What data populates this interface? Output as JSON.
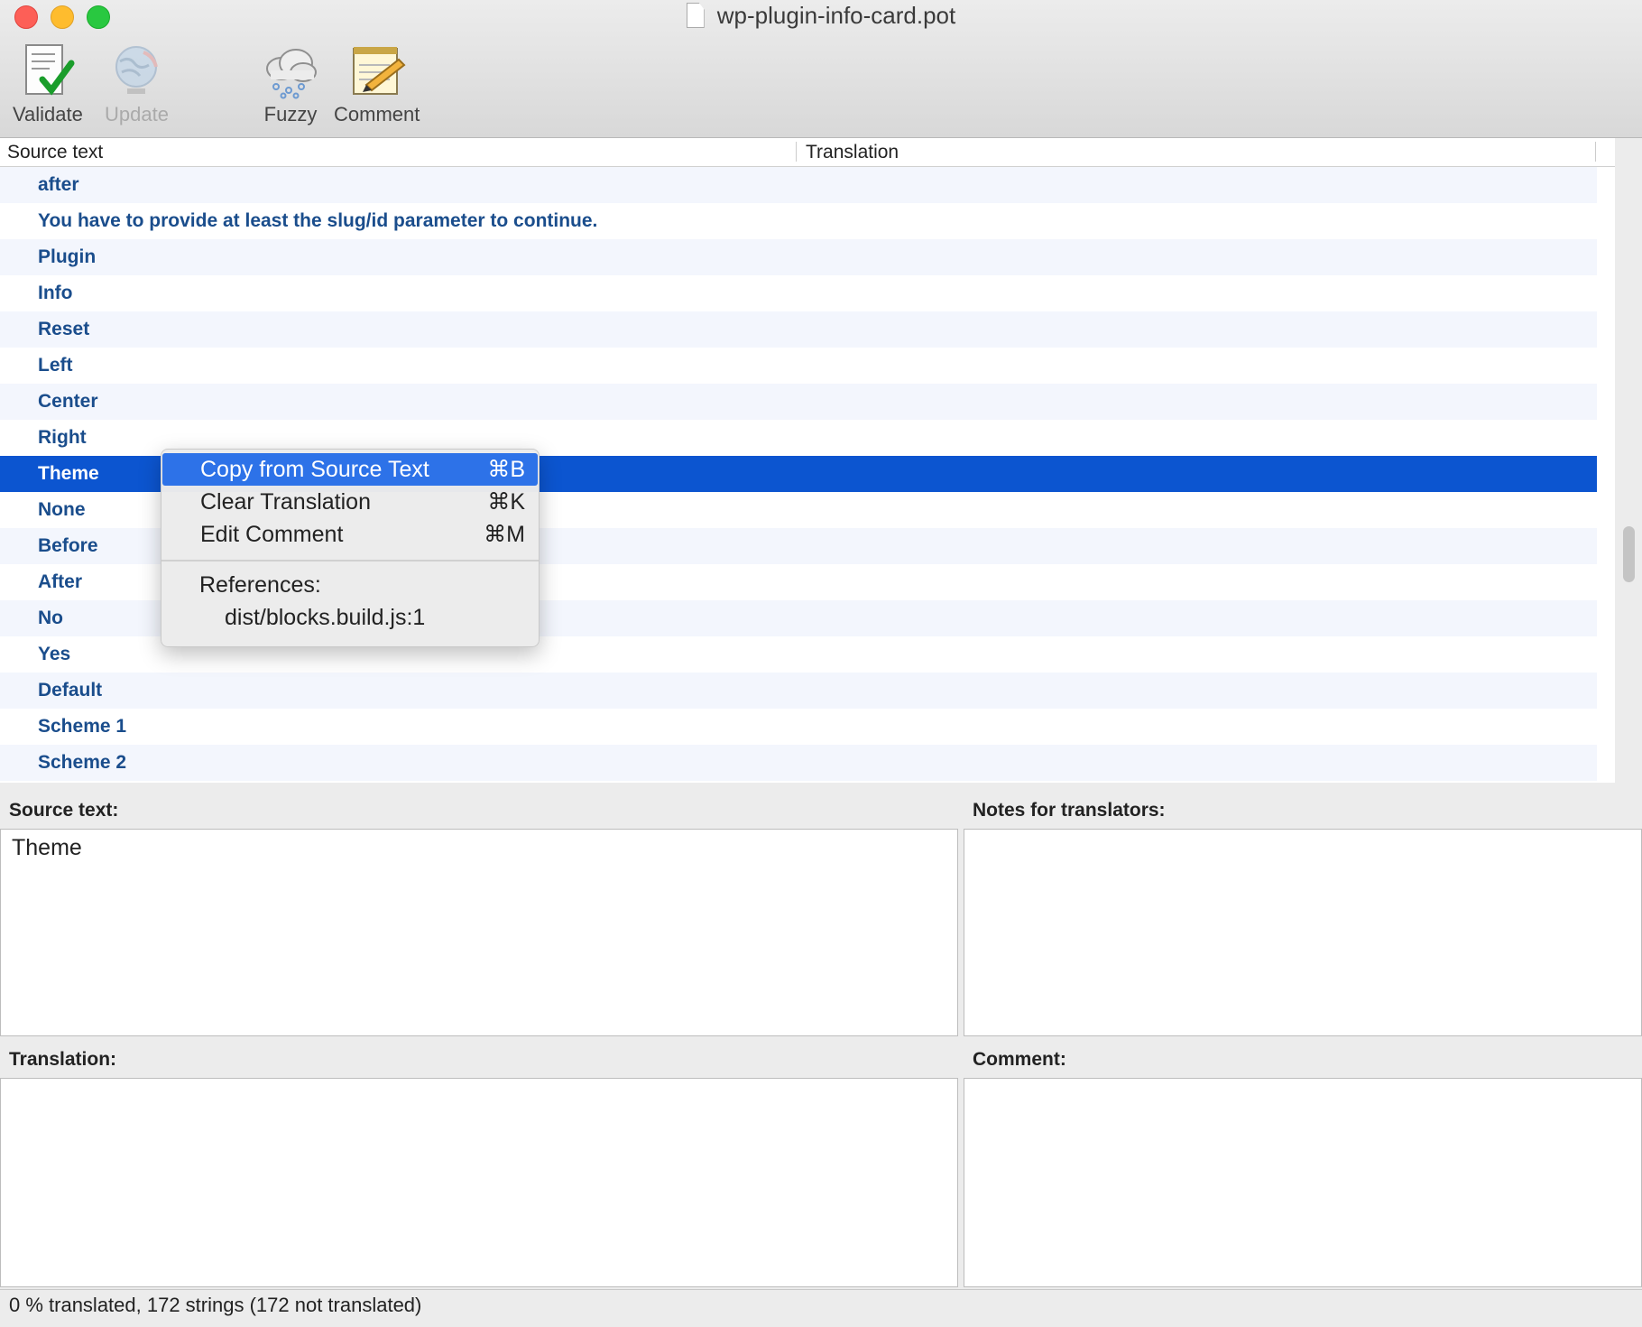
{
  "window": {
    "title": "wp-plugin-info-card.pot"
  },
  "toolbar": {
    "validate": "Validate",
    "update": "Update",
    "fuzzy": "Fuzzy",
    "comment": "Comment"
  },
  "table": {
    "col_source": "Source text",
    "col_translation": "Translation",
    "rows": [
      "after",
      "You have to provide at least the slug/id parameter to continue.",
      "Plugin",
      "Info",
      "Reset",
      "Left",
      "Center",
      "Right",
      "Theme",
      "None",
      "Before",
      "After",
      "No",
      "Yes",
      "Default",
      "Scheme 1",
      "Scheme 2"
    ],
    "selected_index": 8
  },
  "context_menu": {
    "items": [
      {
        "label": "Copy from Source Text",
        "shortcut": "⌘B"
      },
      {
        "label": "Clear Translation",
        "shortcut": "⌘K"
      },
      {
        "label": "Edit Comment",
        "shortcut": "⌘M"
      }
    ],
    "references_label": "References:",
    "reference": "dist/blocks.build.js:1"
  },
  "panes": {
    "source_label": "Source text:",
    "source_value": "Theme",
    "notes_label": "Notes for translators:",
    "notes_value": "",
    "translation_label": "Translation:",
    "translation_value": "",
    "comment_label": "Comment:",
    "comment_value": ""
  },
  "status": {
    "text": "0 % translated, 172 strings (172 not translated)"
  }
}
